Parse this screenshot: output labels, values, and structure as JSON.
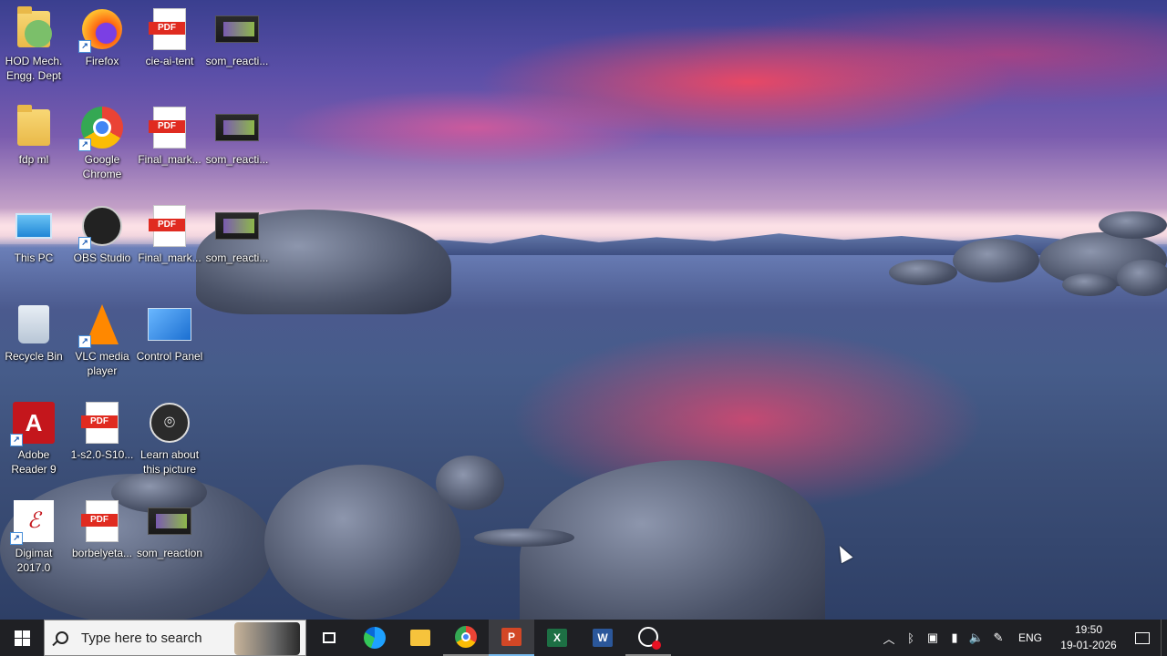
{
  "desktop": {
    "icons": [
      {
        "label": "HOD Mech. Engg. Dept",
        "icon": "user-folder-icon"
      },
      {
        "label": "Firefox",
        "icon": "firefox-icon"
      },
      {
        "label": "cie-ai-tent",
        "icon": "pdf-icon"
      },
      {
        "label": "som_reacti...",
        "icon": "video-icon"
      },
      {
        "label": "fdp ml",
        "icon": "folder-icon"
      },
      {
        "label": "Google Chrome",
        "icon": "chrome-icon"
      },
      {
        "label": "Final_mark...",
        "icon": "pdf-icon"
      },
      {
        "label": "som_reacti...",
        "icon": "video-icon"
      },
      {
        "label": "This PC",
        "icon": "computer-icon"
      },
      {
        "label": "OBS Studio",
        "icon": "obs-icon"
      },
      {
        "label": "Final_mark...",
        "icon": "pdf-icon"
      },
      {
        "label": "som_reacti...",
        "icon": "video-icon"
      },
      {
        "label": "Recycle Bin",
        "icon": "recycle-bin-icon"
      },
      {
        "label": "VLC media player",
        "icon": "vlc-icon"
      },
      {
        "label": "Control Panel",
        "icon": "control-panel-icon"
      },
      {
        "label": "Adobe Reader 9",
        "icon": "adobe-reader-icon"
      },
      {
        "label": "1-s2.0-S10...",
        "icon": "pdf-icon"
      },
      {
        "label": "Learn about this picture",
        "icon": "camera-icon"
      },
      {
        "label": "Digimat 2017.0",
        "icon": "digimat-icon"
      },
      {
        "label": "borbelyeta...",
        "icon": "pdf-icon"
      },
      {
        "label": "som_reaction",
        "icon": "video-icon"
      }
    ]
  },
  "taskbar": {
    "search_placeholder": "Type here to search",
    "pinned": [
      {
        "name": "task-view",
        "icon": "task-view-icon"
      },
      {
        "name": "edge",
        "icon": "edge-icon"
      },
      {
        "name": "file-explorer",
        "icon": "folder-icon"
      },
      {
        "name": "chrome",
        "icon": "chrome-icon"
      },
      {
        "name": "powerpoint",
        "icon": "powerpoint-icon",
        "active": true
      },
      {
        "name": "excel",
        "icon": "excel-icon"
      },
      {
        "name": "word",
        "icon": "word-icon"
      },
      {
        "name": "recorder",
        "icon": "screen-recorder-icon"
      }
    ],
    "tray": {
      "language": "ENG",
      "time": "19:50",
      "date": "19-01-2026"
    }
  }
}
